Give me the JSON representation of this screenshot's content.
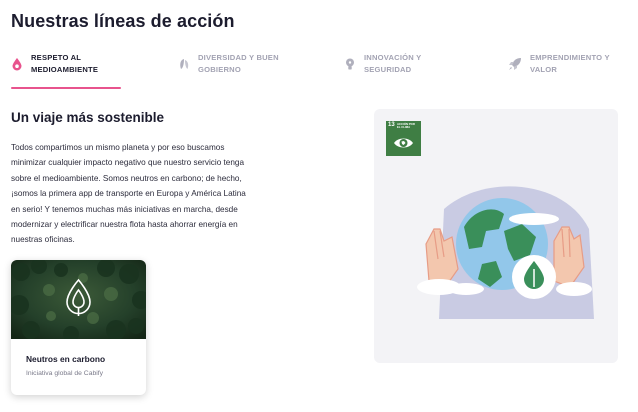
{
  "page": {
    "title": "Nuestras líneas de acción"
  },
  "tabs": [
    {
      "label_line1": "RESPETO AL",
      "label_line2": "MEDIOAMBIENTE",
      "icon": "drop-icon",
      "active": true
    },
    {
      "label_line1": "DIVERSIDAD Y BUEN",
      "label_line2": "GOBIERNO",
      "icon": "leaf-icon",
      "active": false
    },
    {
      "label_line1": "INNOVACIÓN Y",
      "label_line2": "SEGURIDAD",
      "icon": "lightbulb-icon",
      "active": false
    },
    {
      "label_line1": "EMPRENDIMIENTO Y",
      "label_line2": "VALOR",
      "icon": "rocket-icon",
      "active": false
    }
  ],
  "section": {
    "title": "Un viaje más sostenible",
    "body_lines": [
      "Todos compartimos un mismo planeta y por eso buscamos",
      "minimizar cualquier impacto negativo que nuestro servicio tenga",
      "sobre el medioambiente. Somos neutros en carbono; de hecho,",
      "¡somos la primera app de transporte en Europa y América Latina",
      "en serio! Y tenemos muchas más iniciativas en marcha, desde",
      "modernizar y electrificar nuestra flota hasta ahorrar energía en",
      "nuestras oficinas."
    ]
  },
  "card": {
    "title": "Neutros en carbono",
    "subtitle": "Iniciativa global de Cabify"
  },
  "sdg": {
    "number": "13",
    "text": "ACCIÓN POR EL CLIMA"
  },
  "colors": {
    "accent": "#e8538d",
    "sdg_green": "#3f7e44",
    "muted": "#a3a3b3"
  }
}
